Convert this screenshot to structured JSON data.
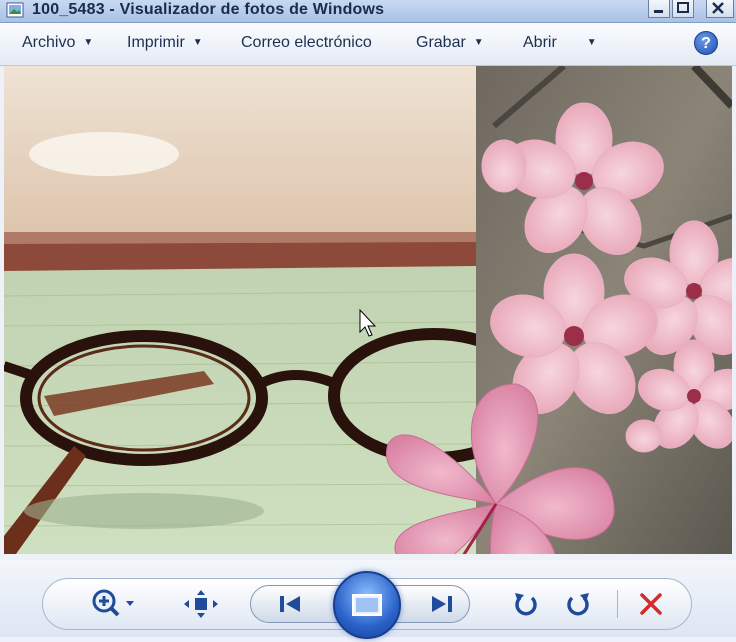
{
  "window": {
    "title": "100_5483 - Visualizador de fotos de Windows"
  },
  "menu": {
    "items": [
      {
        "label": "Archivo"
      },
      {
        "label": "Imprimir"
      },
      {
        "label": "Correo electrónico"
      },
      {
        "label": "Grabar"
      },
      {
        "label": "Abrir"
      }
    ],
    "help_label": "?"
  },
  "toolbar": {
    "zoom": {
      "icon": "zoom-in-icon"
    },
    "fit": {
      "icon": "fit-window-icon"
    },
    "previous": {
      "icon": "previous-icon"
    },
    "slideshow": {
      "icon": "slideshow-icon"
    },
    "next": {
      "icon": "next-icon"
    },
    "rotate_left": {
      "icon": "rotate-counterclockwise-icon"
    },
    "rotate_right": {
      "icon": "rotate-clockwise-icon"
    },
    "delete": {
      "icon": "delete-icon"
    }
  },
  "colors": {
    "accent": "#2a62c9",
    "delete": "#d12b2b"
  }
}
